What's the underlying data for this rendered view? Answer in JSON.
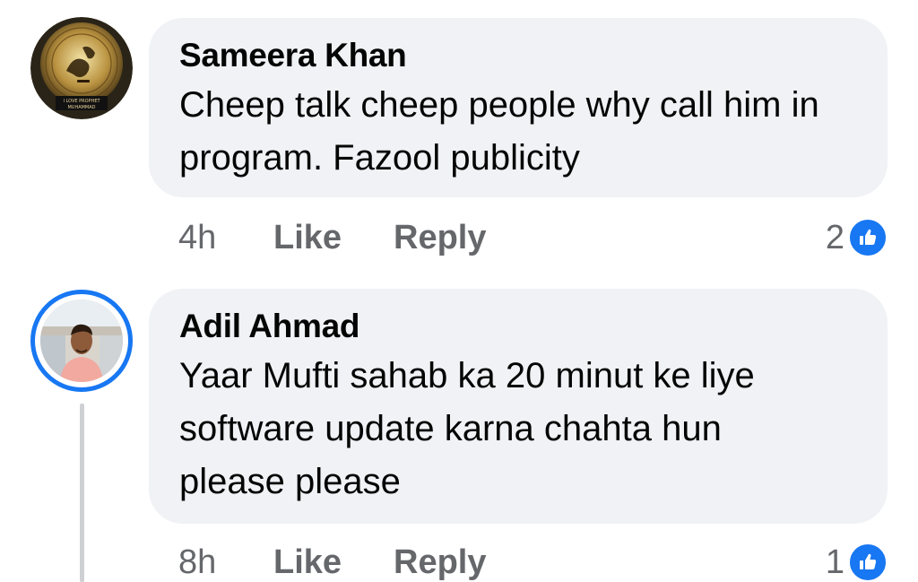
{
  "comments": [
    {
      "author": "Sameera Khan",
      "text": "Cheep talk cheep people why call him in program. Fazool publicity",
      "time": "4h",
      "like_label": "Like",
      "reply_label": "Reply",
      "reaction_count": "2",
      "avatar_icon": "calligraphy-avatar-icon",
      "avatar_caption": "I LOVE PROPHET MUHAMMAD"
    },
    {
      "author": "Adil Ahmad",
      "text": "Yaar Mufti sahab ka 20 minut ke liye software update karna chahta hun please please",
      "time": "8h",
      "like_label": "Like",
      "reply_label": "Reply",
      "reaction_count": "1",
      "avatar_icon": "profile-photo-avatar-icon"
    }
  ],
  "colors": {
    "bubble": "#f0f2f5",
    "meta_text": "#65676b",
    "like_blue": "#1877f2",
    "story_ring": "#1877f2"
  }
}
